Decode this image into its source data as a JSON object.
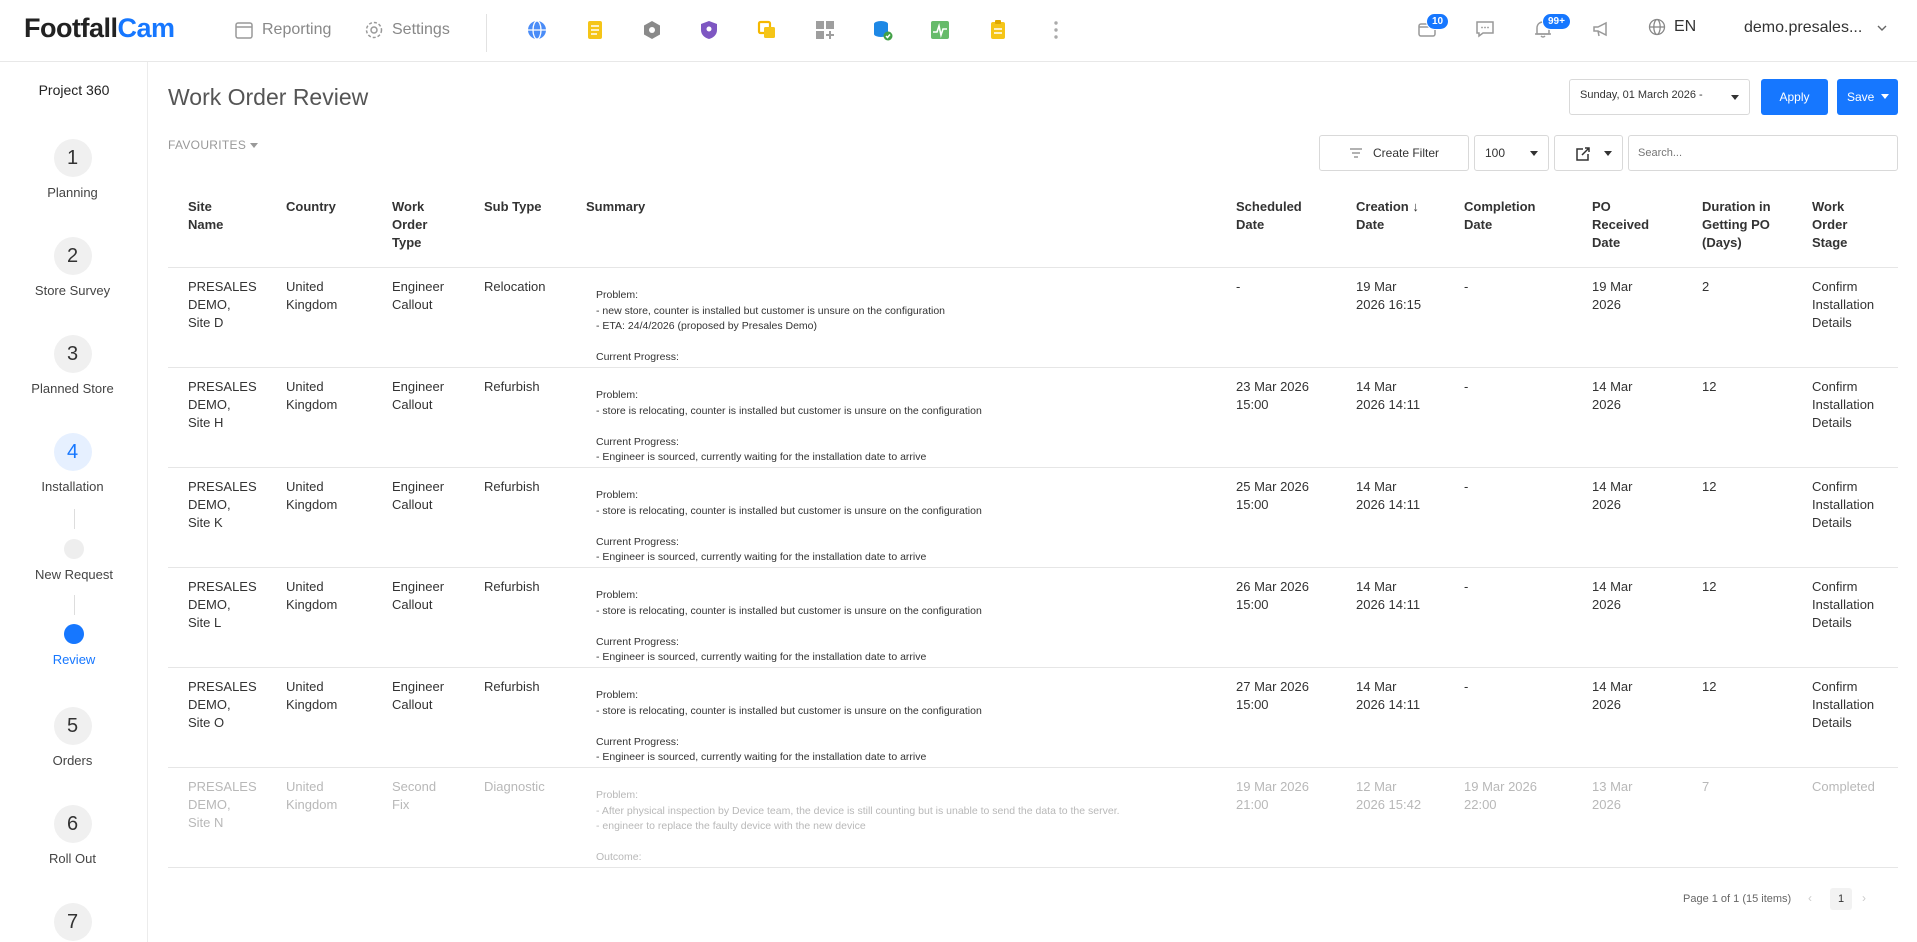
{
  "logo": {
    "part1": "Footfall",
    "part2": "Cam"
  },
  "topnav": {
    "reporting": "Reporting",
    "settings": "Settings"
  },
  "app_icons": [
    "globe-icon",
    "notes-icon",
    "hexagon-icon",
    "shield-user-icon",
    "layers-icon",
    "apps-add-icon",
    "database-check-icon",
    "activity-chart-icon",
    "clipboard-icon",
    "more-vertical-icon"
  ],
  "header_right": {
    "box_badge": "10",
    "bell_badge": "99+",
    "language": "EN",
    "user": "demo.presales..."
  },
  "sidebar": {
    "title": "Project 360",
    "steps": [
      {
        "num": "1",
        "label": "Planning"
      },
      {
        "num": "2",
        "label": "Store Survey"
      },
      {
        "num": "3",
        "label": "Planned Store"
      },
      {
        "num": "4",
        "label": "Installation"
      },
      {
        "num": "5",
        "label": "Orders"
      },
      {
        "num": "6",
        "label": "Roll Out"
      },
      {
        "num": "7",
        "label": ""
      }
    ],
    "substeps": [
      {
        "label": "New Request"
      },
      {
        "label": "Review"
      }
    ]
  },
  "page": {
    "title": "Work Order Review",
    "date_value": "Sunday, 01 March 2026 -",
    "apply_label": "Apply",
    "save_label": "Save",
    "favourites_label": "FAVOURITES",
    "create_filter_label": "Create Filter",
    "page_size": "100",
    "search_placeholder": "Search..."
  },
  "table": {
    "columns": {
      "site": "Site\nName",
      "country": "Country",
      "type": "Work\nOrder\nType",
      "subtype": "Sub Type",
      "summary": "Summary",
      "scheduled": "Scheduled\nDate",
      "creation": "Creation ↓\nDate",
      "completion": "Completion\nDate",
      "po_received": "PO\nReceived\nDate",
      "duration": "Duration in\nGetting PO\n(Days)",
      "stage": "Work\nOrder\nStage"
    },
    "rows": [
      {
        "site": "PRESALES\nDEMO,\nSite D",
        "country": "United\nKingdom",
        "type": "Engineer\nCallout",
        "subtype": "Relocation",
        "summary": "Problem:\n- new store, counter is installed but customer is unsure on the configuration\n- ETA: 24/4/2026 (proposed by Presales Demo)\n\nCurrent Progress:",
        "scheduled": "-",
        "creation": "19 Mar\n2026 16:15",
        "completion": "-",
        "po_received": "19 Mar\n2026",
        "duration": "2",
        "stage": "Confirm\nInstallation\nDetails",
        "muted": false
      },
      {
        "site": "PRESALES\nDEMO,\nSite H",
        "country": "United\nKingdom",
        "type": "Engineer\nCallout",
        "subtype": "Refurbish",
        "summary": "Problem:\n- store is relocating, counter is installed but customer is unsure on the configuration\n\nCurrent Progress:\n- Engineer is sourced, currently waiting for the installation date to arrive",
        "scheduled": "23 Mar 2026\n15:00",
        "creation": "14 Mar\n2026 14:11",
        "completion": "-",
        "po_received": "14 Mar\n2026",
        "duration": "12",
        "stage": "Confirm\nInstallation\nDetails",
        "muted": false
      },
      {
        "site": "PRESALES\nDEMO,\nSite K",
        "country": "United\nKingdom",
        "type": "Engineer\nCallout",
        "subtype": "Refurbish",
        "summary": "Problem:\n- store is relocating, counter is installed but customer is unsure on the configuration\n\nCurrent Progress:\n- Engineer is sourced, currently waiting for the installation date to arrive",
        "scheduled": "25 Mar 2026\n15:00",
        "creation": "14 Mar\n2026 14:11",
        "completion": "-",
        "po_received": "14 Mar\n2026",
        "duration": "12",
        "stage": "Confirm\nInstallation\nDetails",
        "muted": false
      },
      {
        "site": "PRESALES\nDEMO,\nSite L",
        "country": "United\nKingdom",
        "type": "Engineer\nCallout",
        "subtype": "Refurbish",
        "summary": "Problem:\n- store is relocating, counter is installed but customer is unsure on the configuration\n\nCurrent Progress:\n- Engineer is sourced, currently waiting for the installation date to arrive",
        "scheduled": "26 Mar 2026\n15:00",
        "creation": "14 Mar\n2026 14:11",
        "completion": "-",
        "po_received": "14 Mar\n2026",
        "duration": "12",
        "stage": "Confirm\nInstallation\nDetails",
        "muted": false
      },
      {
        "site": "PRESALES\nDEMO,\nSite O",
        "country": "United\nKingdom",
        "type": "Engineer\nCallout",
        "subtype": "Refurbish",
        "summary": "Problem:\n- store is relocating, counter is installed but customer is unsure on the configuration\n\nCurrent Progress:\n- Engineer is sourced, currently waiting for the installation date to arrive",
        "scheduled": "27 Mar 2026\n15:00",
        "creation": "14 Mar\n2026 14:11",
        "completion": "-",
        "po_received": "14 Mar\n2026",
        "duration": "12",
        "stage": "Confirm\nInstallation\nDetails",
        "muted": false
      },
      {
        "site": "PRESALES\nDEMO,\nSite N",
        "country": "United\nKingdom",
        "type": "Second\nFix",
        "subtype": "Diagnostic",
        "summary": "Problem:\n- After physical inspection by Device team, the device is still counting but is unable to send the data to the server.\n- engineer to replace the faulty device with the new device\n\nOutcome:",
        "scheduled": "19 Mar 2026\n21:00",
        "creation": "12 Mar\n2026 15:42",
        "completion": "19 Mar 2026\n22:00",
        "po_received": "13 Mar\n2026",
        "duration": "7",
        "stage": "Completed",
        "muted": true
      }
    ]
  },
  "pagination": {
    "info": "Page 1 of 1 (15 items)",
    "current": "1",
    "prev": "‹",
    "next": "›"
  },
  "colors": {
    "accent": "#1677ff",
    "muted_text": "#b8b8b8"
  }
}
